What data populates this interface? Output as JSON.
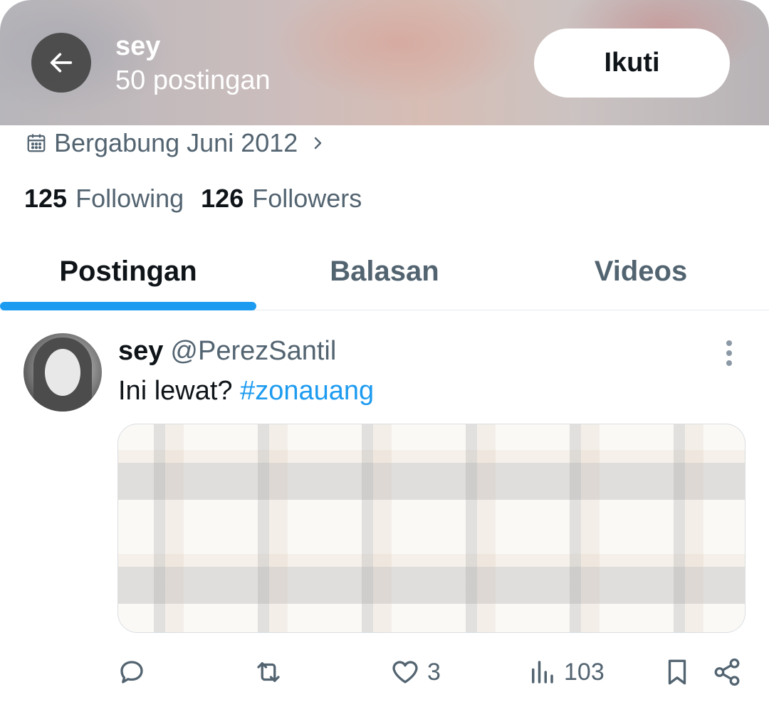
{
  "header": {
    "name": "sey",
    "post_count": "50 postingan",
    "follow_label": "Ikuti"
  },
  "profile": {
    "joined": "Bergabung Juni 2012",
    "following_count": "125",
    "following_label": "Following",
    "followers_count": "126",
    "followers_label": "Followers"
  },
  "tabs": [
    {
      "label": "Postingan",
      "active": true
    },
    {
      "label": "Balasan",
      "active": false
    },
    {
      "label": "Videos",
      "active": false
    }
  ],
  "post": {
    "author_name": "sey",
    "handle": "@PerezSantil",
    "text": "Ini lewat?",
    "hashtag": "#zonauang",
    "actions": {
      "reply_count": "",
      "repost_count": "",
      "like_count": "3",
      "views_count": "103"
    }
  },
  "colors": {
    "accent": "#1d9bf0",
    "text_primary": "#0f1419",
    "text_secondary": "#536471"
  },
  "icons": [
    "back-arrow-icon",
    "calendar-icon",
    "chevron-right-icon",
    "more-options-icon",
    "reply-icon",
    "repost-icon",
    "like-icon",
    "views-icon",
    "bookmark-icon",
    "share-icon"
  ]
}
